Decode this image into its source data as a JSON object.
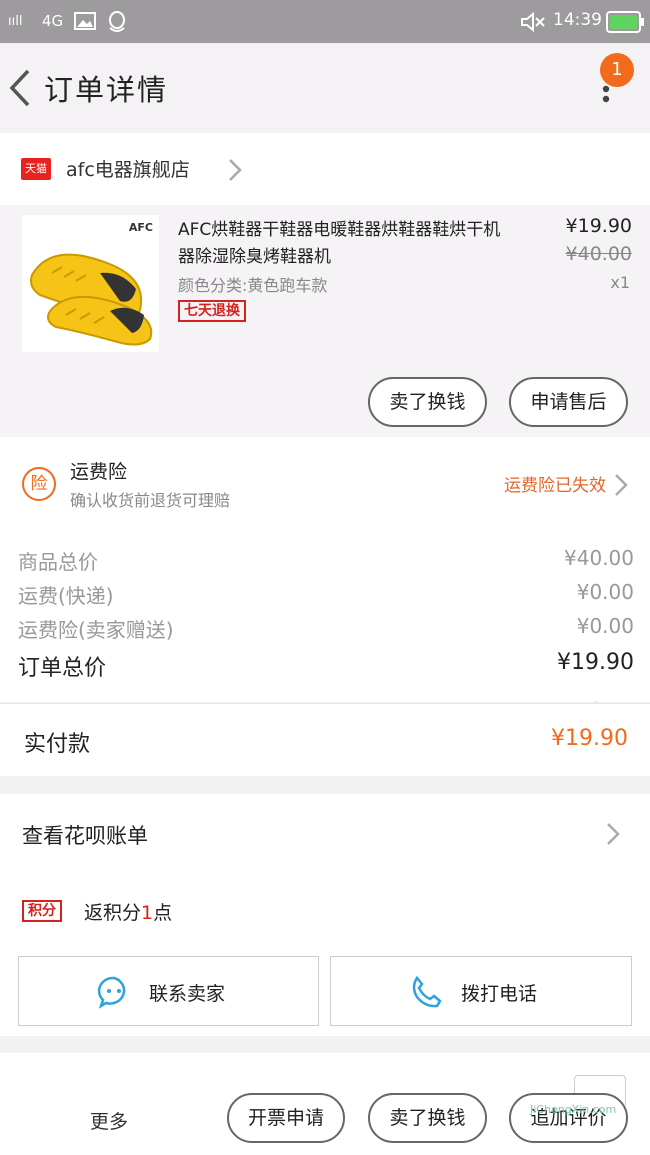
{
  "status_bar": {
    "signal": "ııll",
    "network": "4G",
    "time": "14:39"
  },
  "header": {
    "title": "订单详情",
    "badge": "1"
  },
  "shop": {
    "platform_logo": "天猫",
    "name": "afc电器旗舰店"
  },
  "product": {
    "brand_mark": "AFC",
    "title": "AFC烘鞋器干鞋器电暖鞋器烘鞋器鞋烘干机器除湿除臭烤鞋器机",
    "spec": "颜色分类:黄色跑车款",
    "tag": "七天退换",
    "price": "¥19.90",
    "original_price": "¥40.00",
    "quantity": "x1",
    "buttons": [
      "卖了换钱",
      "申请售后"
    ]
  },
  "insurance": {
    "icon_char": "险",
    "title": "运费险",
    "subtitle": "确认收货前退货可理赔",
    "status": "运费险已失效"
  },
  "summary": {
    "rows": [
      {
        "label": "商品总价",
        "value": "¥40.00"
      },
      {
        "label": "运费(快递)",
        "value": "¥0.00"
      },
      {
        "label": "运费险(卖家赠送)",
        "value": "¥0.00"
      }
    ],
    "total_label": "订单总价",
    "total_value": "¥19.90"
  },
  "payment": {
    "label": "实付款",
    "value": "¥19.90"
  },
  "bill": {
    "label": "查看花呗账单"
  },
  "points": {
    "tag": "积分",
    "prefix": "返积分",
    "count": "1",
    "suffix": "点"
  },
  "contact": {
    "seller_label": "联系卖家",
    "call_label": "拨打电话"
  },
  "bottom_bar": {
    "more_label": "更多",
    "buttons": [
      "开票申请",
      "卖了换钱",
      "追加评价"
    ]
  },
  "watermark": {
    "text": "JiChengXin.com"
  },
  "colors": {
    "accent": "#f26a1b",
    "tmall_red": "#e8231f",
    "contact_blue": "#2aa3e0",
    "status_bar": "#9d9b9d"
  }
}
